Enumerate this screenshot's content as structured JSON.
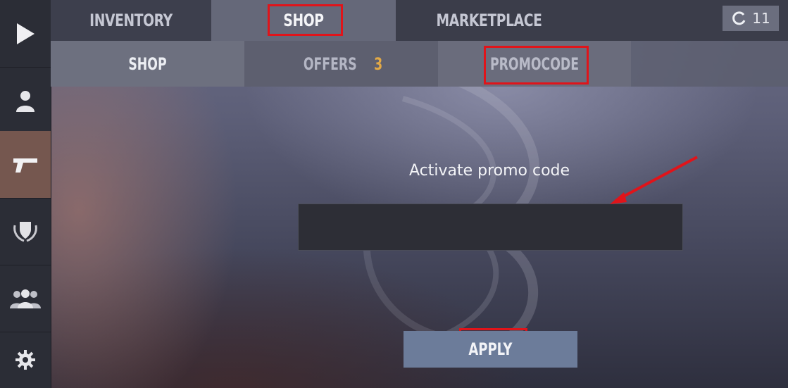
{
  "topnav": {
    "tabs": [
      {
        "label": "INVENTORY"
      },
      {
        "label": "SHOP"
      },
      {
        "label": "MARKETPLACE"
      }
    ],
    "counter": "11"
  },
  "subnav": {
    "tabs": [
      {
        "label": "SHOP"
      },
      {
        "label": "OFFERS"
      },
      {
        "label": "PROMOCODE"
      }
    ],
    "offers_badge": "3"
  },
  "sidebar": {
    "items": [
      {
        "icon": "play-icon"
      },
      {
        "icon": "user-icon"
      },
      {
        "icon": "pistol-icon"
      },
      {
        "icon": "shield-laurel-icon"
      },
      {
        "icon": "group-icon"
      },
      {
        "icon": "gear-icon"
      }
    ]
  },
  "promo": {
    "title": "Activate promo code",
    "input_value": "",
    "apply_label": "APPLY"
  },
  "colors": {
    "highlight": "#e0141a",
    "badge": "#e2a946",
    "apply_button": "#6c7c9a"
  }
}
